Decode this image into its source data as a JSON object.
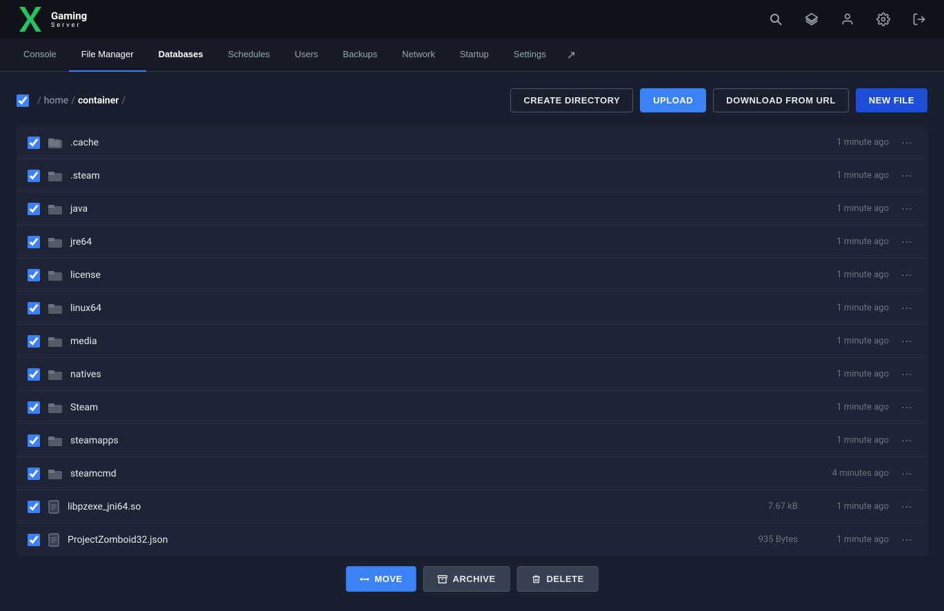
{
  "topbar": {
    "logo_text_line1": "Gaming",
    "logo_text_line2": "Server",
    "icons": [
      "search-icon",
      "layers-icon",
      "user-icon",
      "settings-icon",
      "logout-icon"
    ]
  },
  "nav": {
    "tabs": [
      {
        "label": "Console",
        "active": false,
        "bold": false
      },
      {
        "label": "File Manager",
        "active": true,
        "bold": false
      },
      {
        "label": "Databases",
        "active": false,
        "bold": true
      },
      {
        "label": "Schedules",
        "active": false,
        "bold": false
      },
      {
        "label": "Users",
        "active": false,
        "bold": false
      },
      {
        "label": "Backups",
        "active": false,
        "bold": false
      },
      {
        "label": "Network",
        "active": false,
        "bold": false
      },
      {
        "label": "Startup",
        "active": false,
        "bold": false
      },
      {
        "label": "Settings",
        "active": false,
        "bold": false
      }
    ]
  },
  "breadcrumb": {
    "separator": "/",
    "home": "home",
    "current": "container"
  },
  "actions": {
    "create_directory": "CREATE DIRECTORY",
    "upload": "UPLOAD",
    "download_from_url": "DOWNLOAD FROM URL",
    "new_file": "NEW FILE"
  },
  "files": [
    {
      "name": ".cache",
      "type": "folder",
      "size": "",
      "time": "1 minute ago"
    },
    {
      "name": ".steam",
      "type": "folder",
      "size": "",
      "time": "1 minute ago"
    },
    {
      "name": "java",
      "type": "folder",
      "size": "",
      "time": "1 minute ago"
    },
    {
      "name": "jre64",
      "type": "folder",
      "size": "",
      "time": "1 minute ago"
    },
    {
      "name": "license",
      "type": "folder",
      "size": "",
      "time": "1 minute ago"
    },
    {
      "name": "linux64",
      "type": "folder",
      "size": "",
      "time": "1 minute ago"
    },
    {
      "name": "media",
      "type": "folder",
      "size": "",
      "time": "1 minute ago"
    },
    {
      "name": "natives",
      "type": "folder",
      "size": "",
      "time": "1 minute ago"
    },
    {
      "name": "Steam",
      "type": "folder",
      "size": "",
      "time": "1 minute ago"
    },
    {
      "name": "steamapps",
      "type": "folder",
      "size": "",
      "time": "1 minute ago"
    },
    {
      "name": "steamcmd",
      "type": "folder",
      "size": "",
      "time": "4 minutes ago"
    },
    {
      "name": "libpzexe_jni64.so",
      "type": "file",
      "size": "7.67 kB",
      "time": "1 minute ago"
    },
    {
      "name": "ProjectZomboid32.json",
      "type": "file",
      "size": "935 Bytes",
      "time": "1 minute ago"
    }
  ],
  "bottom_actions": {
    "move": "MOVE",
    "archive": "ARCHIVE",
    "delete": "DELETE"
  },
  "colors": {
    "accent_blue": "#3b82f6",
    "bg_dark": "#1a1f2e",
    "bg_darker": "#0f1219"
  }
}
